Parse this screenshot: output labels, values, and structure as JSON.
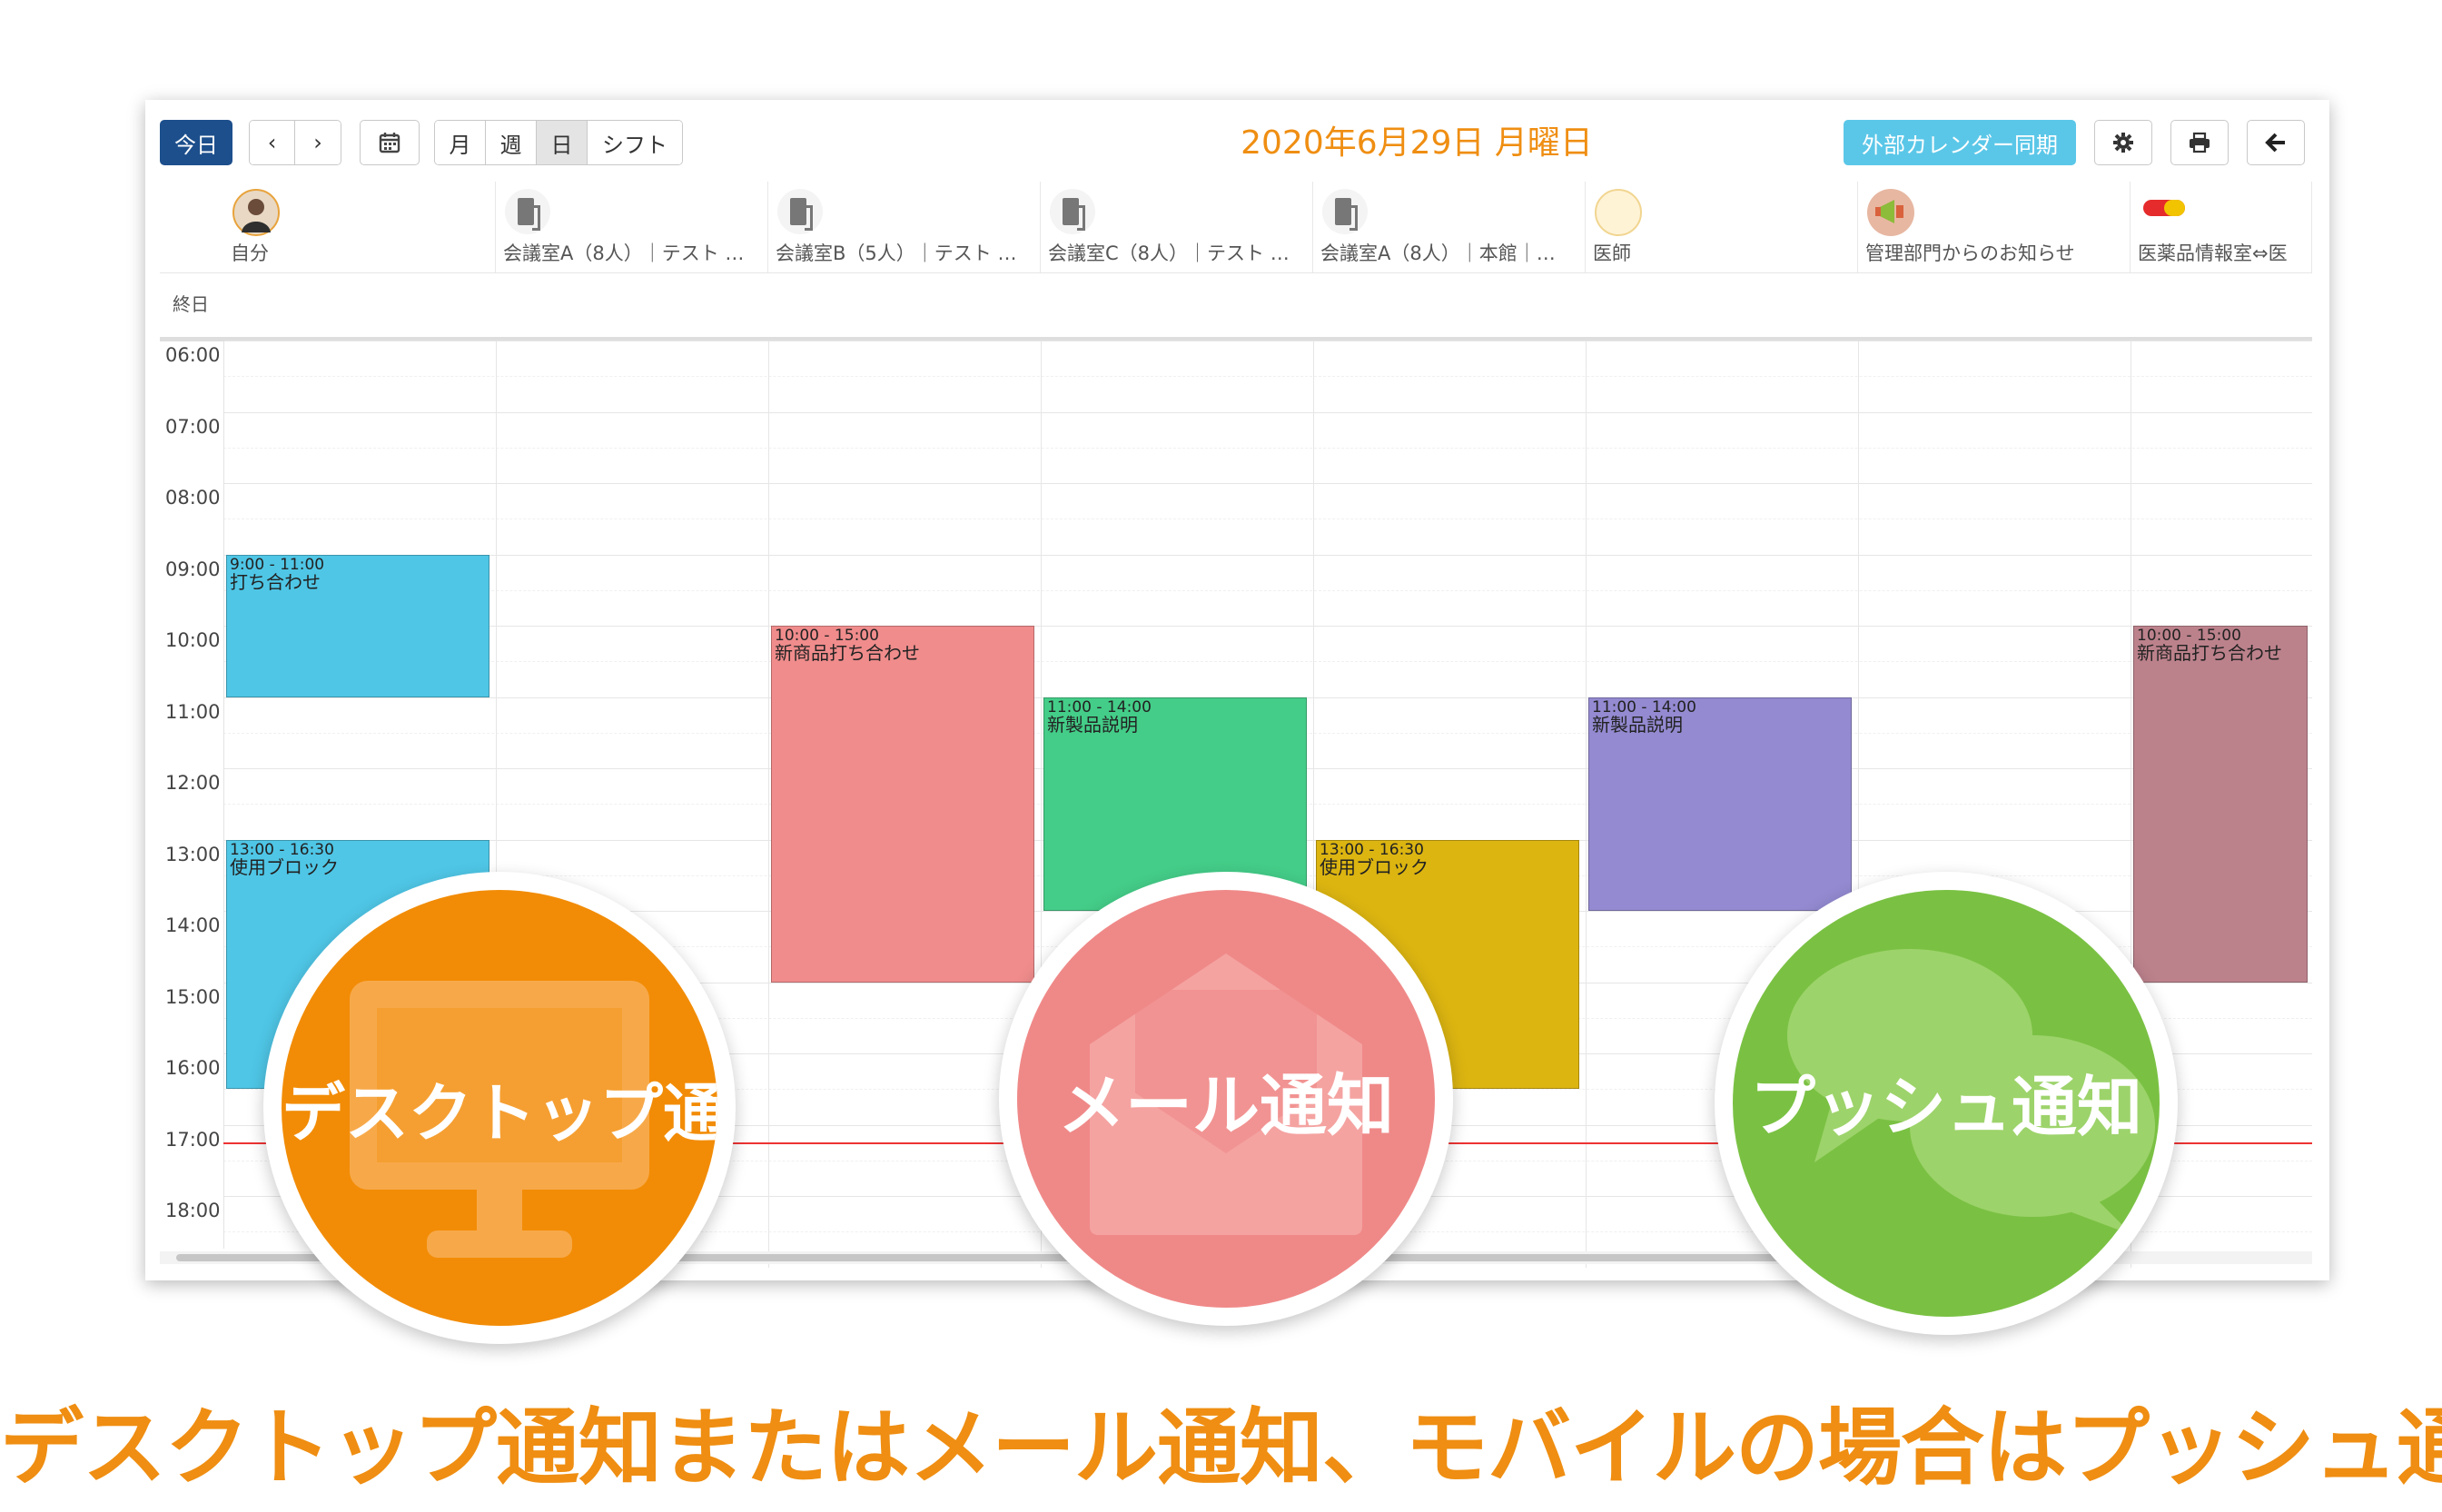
{
  "toolbar": {
    "today_label": "今日",
    "prev_label": "‹",
    "next_label": "›",
    "calendar_icon": "calendar-icon",
    "view_month": "月",
    "view_week": "週",
    "view_day": "日",
    "view_shift": "シフト",
    "date_title": "2020年6月29日 月曜日",
    "sync_label": "外部カレンダー同期",
    "settings_icon": "gear-icon",
    "print_icon": "print-icon",
    "back_icon": "arrow-left-icon",
    "active_view": "日"
  },
  "columns": [
    {
      "label": "自分",
      "icon": "avatar"
    },
    {
      "label": "会議室A（8人）｜テスト …",
      "icon": "door-icon"
    },
    {
      "label": "会議室B（5人）｜テスト …",
      "icon": "door-icon"
    },
    {
      "label": "会議室C（8人）｜テスト …",
      "icon": "door-icon"
    },
    {
      "label": "会議室A（8人）｜本館｜…",
      "icon": "door-icon"
    },
    {
      "label": "医師",
      "icon": "doctor-badge-icon"
    },
    {
      "label": "管理部門からのお知らせ",
      "icon": "megaphone-icon"
    },
    {
      "label": "医薬品情報室⇔医",
      "icon": "pill-icon"
    }
  ],
  "allday_label": "終日",
  "times": [
    "06:00",
    "07:00",
    "08:00",
    "09:00",
    "10:00",
    "11:00",
    "12:00",
    "13:00",
    "14:00",
    "15:00",
    "16:00",
    "17:00",
    "18:00"
  ],
  "events": [
    {
      "col": 0,
      "time": "9:00 - 11:00",
      "title": "打ち合わせ",
      "start": 9,
      "end": 11,
      "color": "#4fc6e6"
    },
    {
      "col": 0,
      "time": "13:00 - 16:30",
      "title": "使用ブロック",
      "start": 13,
      "end": 16.5,
      "color": "#4fc6e6"
    },
    {
      "col": 2,
      "time": "10:00 - 15:00",
      "title": "新商品打ち合わせ",
      "start": 10,
      "end": 15,
      "color": "#f08c8c"
    },
    {
      "col": 3,
      "time": "11:00 - 14:00",
      "title": "新製品説明",
      "start": 11,
      "end": 14,
      "color": "#44cd88"
    },
    {
      "col": 4,
      "time": "13:00 - 16:30",
      "title": "使用ブロック",
      "start": 13,
      "end": 16.5,
      "color": "#dcb511"
    },
    {
      "col": 5,
      "time": "11:00 - 14:00",
      "title": "新製品説明",
      "start": 11,
      "end": 14,
      "color": "#938ad1"
    },
    {
      "col": 7,
      "time": "10:00 - 15:00",
      "title": "新商品打ち合わせ",
      "start": 10,
      "end": 15,
      "color": "#bc828c"
    }
  ],
  "now_time": 17.25,
  "badges": {
    "desktop": {
      "label": "デスクトップ通知",
      "color": "#f28c06",
      "icon": "monitor-icon"
    },
    "mail": {
      "label": "メール通知",
      "color": "#ef8988",
      "icon": "envelope-icon"
    },
    "push": {
      "label": "プッシュ通知",
      "color": "#7ac143",
      "icon": "chat-bubbles-icon"
    }
  },
  "footer_text": "デスクトップ通知またはメール通知、モバイルの場合はプッシュ通知"
}
